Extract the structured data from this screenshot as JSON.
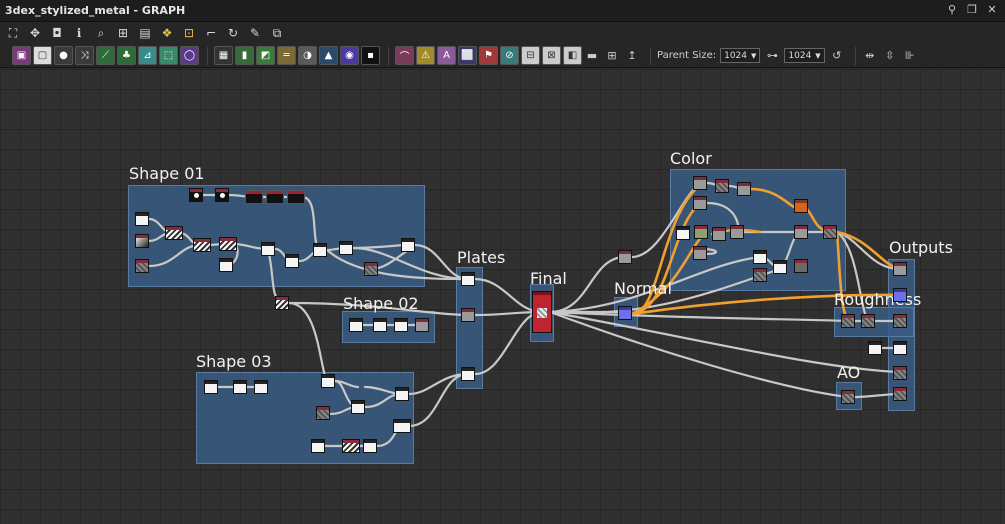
{
  "window": {
    "title": "3dex_stylized_metal - GRAPH"
  },
  "toolbar": {
    "parent_size_label": "Parent Size:",
    "parent_size_width": "1024",
    "parent_size_height": "1024"
  },
  "frames": {
    "shape01": "Shape 01",
    "shape02": "Shape 02",
    "shape03": "Shape 03",
    "plates": "Plates",
    "final": "Final",
    "normal": "Normal",
    "color": "Color",
    "outputs": "Outputs",
    "roughness": "Roughness",
    "ao": "AO"
  },
  "colors": {
    "frame_fill": "#385c82",
    "wire": "#c8c8c8",
    "wire_highlight": "#f0a030",
    "canvas": "#303030"
  },
  "icons": {
    "pin": "pin-icon",
    "restore": "restore-icon",
    "close": "close-icon"
  }
}
